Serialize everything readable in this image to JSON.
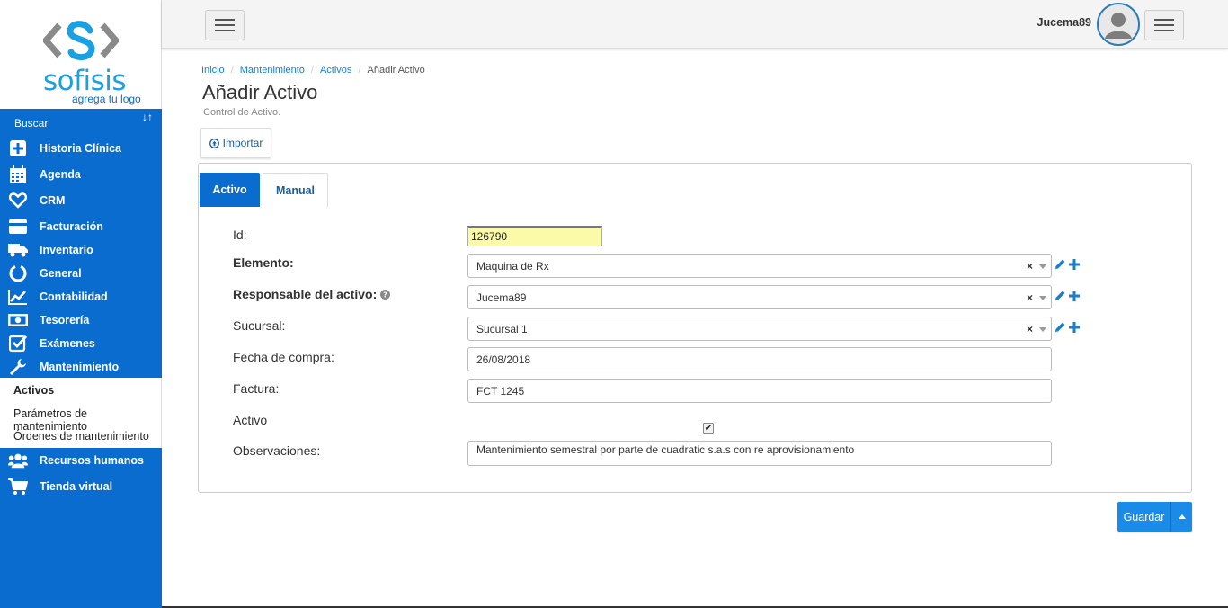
{
  "brand": {
    "name": "sofisis",
    "tagline": "agrega tu logo",
    "accent": "#0a6ccf",
    "logo_color": "#1ba0e2"
  },
  "sidebar": {
    "search_label": "Buscar",
    "sort_icon": "sort-icon",
    "items": [
      {
        "label": "Historia Clínica",
        "icon": "plus-square-icon"
      },
      {
        "label": "Agenda",
        "icon": "calendar-icon"
      },
      {
        "label": "CRM",
        "icon": "heart-icon"
      },
      {
        "label": "Facturación",
        "icon": "credit-card-icon"
      },
      {
        "label": "Inventario",
        "icon": "truck-icon"
      },
      {
        "label": "General",
        "icon": "circle-notch-icon"
      },
      {
        "label": "Contabilidad",
        "icon": "line-chart-icon"
      },
      {
        "label": "Tesorería",
        "icon": "money-icon"
      },
      {
        "label": "Exámenes",
        "icon": "check-square-icon"
      },
      {
        "label": "Mantenimiento",
        "icon": "wrench-icon"
      },
      {
        "label": "Recursos humanos",
        "icon": "users-icon"
      },
      {
        "label": "Tienda virtual",
        "icon": "cart-icon"
      }
    ],
    "submenu": [
      {
        "label": "Activos",
        "active": true
      },
      {
        "label": "Parámetros de mantenimiento",
        "active": false
      },
      {
        "label": "Órdenes de mantenimiento",
        "active": false
      }
    ]
  },
  "topbar": {
    "username": "Jucema89"
  },
  "breadcrumb": [
    "Inicio",
    "Mantenimiento",
    "Activos",
    "Añadir Activo"
  ],
  "page": {
    "title": "Añadir Activo",
    "subtitle": "Control de Activo.",
    "import_label": "Importar"
  },
  "tabs": [
    "Activo",
    "Manual"
  ],
  "form": {
    "id_label": "Id:",
    "id_value": "126790",
    "elemento_label": "Elemento:",
    "elemento_value": "Maquina de Rx",
    "responsable_label": "Responsable del activo:",
    "responsable_value": "Jucema89",
    "sucursal_label": "Sucursal:",
    "sucursal_value": "Sucursal 1",
    "fecha_label": "Fecha de compra:",
    "fecha_value": "26/08/2018",
    "factura_label": "Factura:",
    "factura_value": "FCT 1245",
    "activo_label": "Activo",
    "activo_checked": true,
    "obs_label": "Observaciones:",
    "obs_value": "Mantenimiento semestral por parte de cuadratic s.a.s con re aprovisionamiento",
    "clear_glyph": "×"
  },
  "actions": {
    "save_label": "Guardar"
  }
}
